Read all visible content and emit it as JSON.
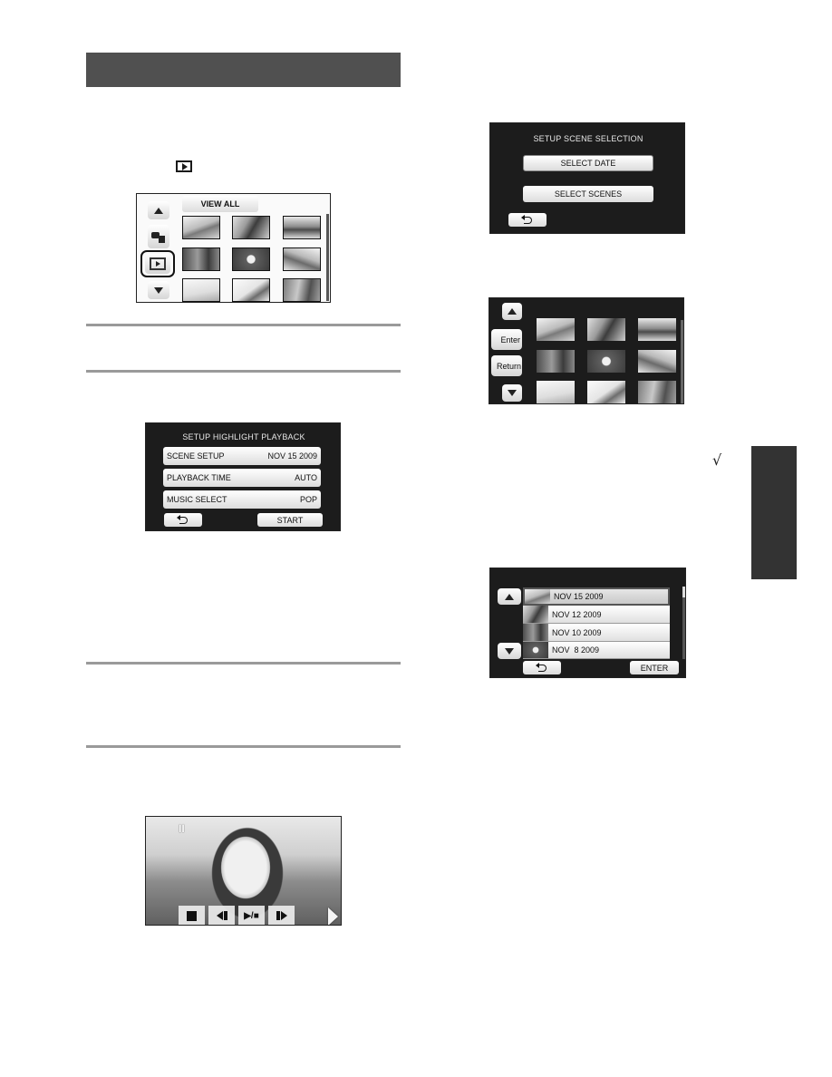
{
  "page": {
    "section_header": "",
    "inline_icon": "play-mode-icon"
  },
  "screen_view_all": {
    "tab_label": "VIEW ALL",
    "side_buttons": [
      "up-arrow",
      "video-photo-mode",
      "play-mode",
      "down-arrow"
    ],
    "thumbnail_count": 9
  },
  "screen_highlight": {
    "title": "SETUP HIGHLIGHT PLAYBACK",
    "rows": [
      {
        "label": "SCENE SETUP",
        "value": "NOV 15 2009"
      },
      {
        "label": "PLAYBACK TIME",
        "value": "AUTO"
      },
      {
        "label": "MUSIC SELECT",
        "value": "POP"
      }
    ],
    "back_label": "",
    "start_label": "START"
  },
  "screen_playback": {
    "pause_indicator": "II",
    "controls": [
      "stop",
      "skip-back",
      "play-pause",
      "skip-forward",
      "next-page"
    ],
    "play_pause_text": "▶/■"
  },
  "screen_scene_selection": {
    "title": "SETUP SCENE SELECTION",
    "select_date_label": "SELECT DATE",
    "select_scenes_label": "SELECT SCENES"
  },
  "screen_select_scenes": {
    "enter_label": "Enter",
    "return_label": "Return",
    "thumbnail_count": 9
  },
  "screen_select_date": {
    "dates": [
      "NOV 15 2009",
      "NOV 12 2009",
      "NOV 10 2009",
      "NOV  8 2009"
    ],
    "selected_index": 0,
    "enter_label": "ENTER"
  },
  "margin": {
    "checkmark": "√"
  },
  "colors": {
    "section_bar": "#505050",
    "side_tab": "#333333",
    "lcd_background": "#1c1c1c",
    "rule": "#9a9a9a"
  }
}
